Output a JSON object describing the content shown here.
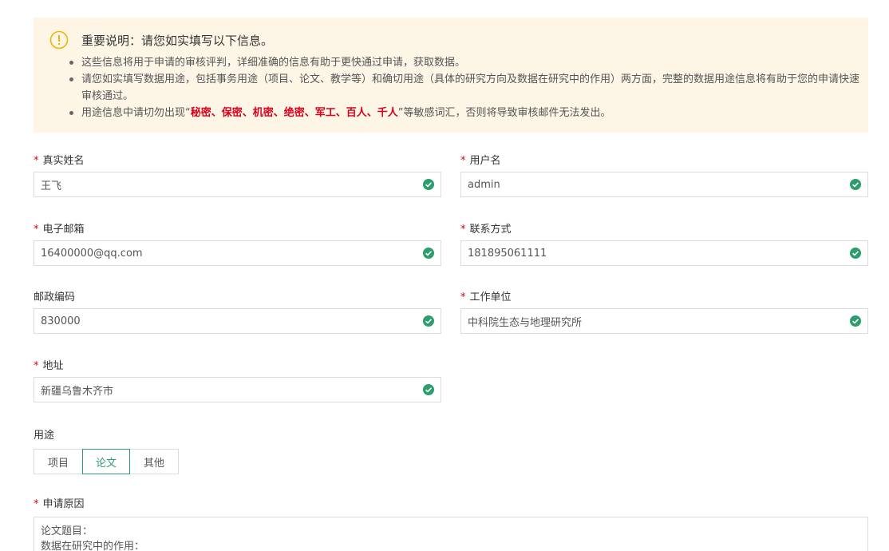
{
  "notice": {
    "title": "重要说明：请您如实填写以下信息。",
    "items": [
      "这些信息将用于申请的审核评判，详细准确的信息有助于更快通过申请，获取数据。",
      "请您如实填写数据用途，包括事务用途（项目、论文、教学等）和确切用途（具体的研究方向及数据在研究中的作用）两方面，完整的数据用途信息将有助于您的申请快速审核通过。"
    ],
    "item3_prefix": "用途信息中请切勿出现“",
    "item3_sensitive": "秘密、保密、机密、绝密、军工、百人、千人",
    "item3_suffix": "”等敏感词汇，否则将导致审核邮件无法发出。"
  },
  "form": {
    "required_mark": "*",
    "real_name": {
      "label": "真实姓名",
      "value": "王飞"
    },
    "username": {
      "label": "用户名",
      "value": "admin"
    },
    "email": {
      "label": "电子邮箱",
      "value": "16400000@qq.com"
    },
    "contact": {
      "label": "联系方式",
      "value": "181895061111"
    },
    "postal": {
      "label": "邮政编码",
      "value": "830000"
    },
    "org": {
      "label": "工作单位",
      "value": "中科院生态与地理研究所"
    },
    "address": {
      "label": "地址",
      "value": "新疆乌鲁木齐市"
    },
    "usage": {
      "label": "用途",
      "options": [
        "项目",
        "论文",
        "其他"
      ],
      "selected": "论文"
    },
    "reason": {
      "label": "申请原因",
      "value": "论文题目：\n数据在研究中的作用："
    }
  },
  "colors": {
    "accent": "#2e9d6e",
    "required": "#d9001b",
    "notice_bg": "#fdf6e6",
    "warn": "#f0b400"
  },
  "icons": {
    "notice": "exclamation-circle-icon",
    "valid": "check-circle-icon"
  }
}
